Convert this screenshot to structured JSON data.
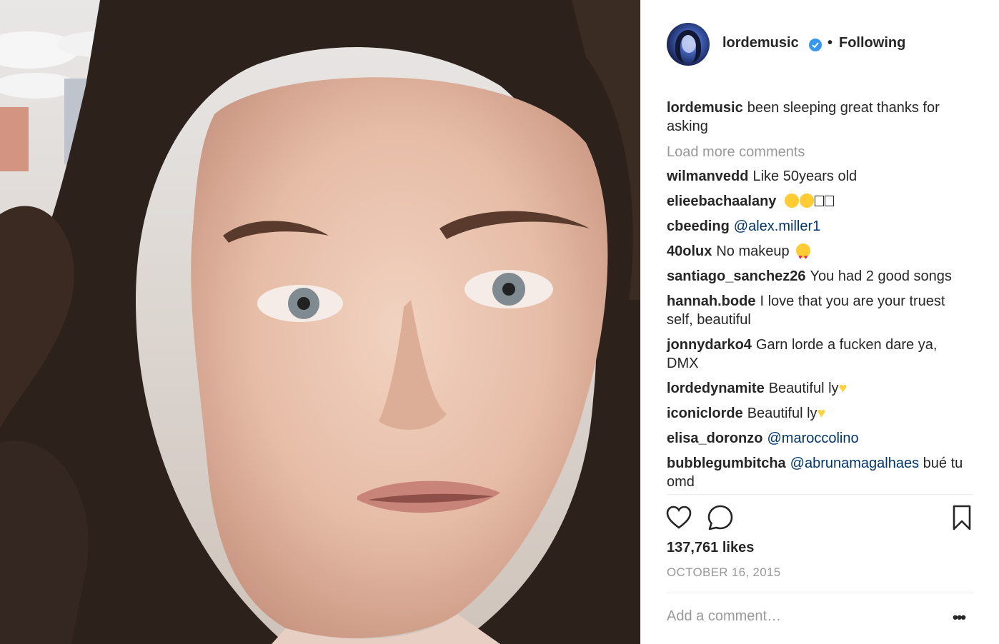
{
  "post": {
    "author": "lordemusic",
    "follow_status": "Following",
    "separator": "•",
    "likes": "137,761 likes",
    "date": "OCTOBER 16, 2015",
    "add_comment_placeholder": "Add a comment…",
    "more_options": "•••"
  },
  "caption": {
    "user": "lordemusic",
    "text": "been sleeping great thanks for asking"
  },
  "load_more": "Load more comments",
  "comments": [
    {
      "user": "wilmanvedd",
      "text": "Like 50years old"
    },
    {
      "user": "elieebachaalany",
      "text": ""
    },
    {
      "user": "cbeeding",
      "mention": "@alex.miller1",
      "text": ""
    },
    {
      "user": "40olux",
      "text": "No makeup"
    },
    {
      "user": "santiago_sanchez26",
      "text": "You had 2 good songs"
    },
    {
      "user": "hannah.bode",
      "text": "I love that you are your truest self, beautiful"
    },
    {
      "user": "jonnydarko4",
      "text": "Garn lorde a fucken dare ya, DMX"
    },
    {
      "user": "lordedynamite",
      "text": "Beautiful ly"
    },
    {
      "user": "iconiclorde",
      "text": "Beautiful ly"
    },
    {
      "user": "elisa_doronzo",
      "mention": "@maroccolino",
      "text": ""
    },
    {
      "user": "bubblegumbitcha",
      "mention": "@abrunamagalhaes",
      "text": "bué tu omd"
    }
  ],
  "icons": {
    "verified": "verified-badge-icon",
    "like": "heart-icon",
    "comment": "comment-bubble-icon",
    "save": "bookmark-icon",
    "emoji_laugh": "tears-of-joy-emoji",
    "emoji_heart_eyes": "heart-eyes-emoji",
    "emoji_yellow_heart": "yellow-heart-emoji"
  },
  "colors": {
    "text": "#262626",
    "muted": "#999999",
    "mention": "#003569",
    "verified": "#3897f0",
    "divider": "#efefef"
  }
}
